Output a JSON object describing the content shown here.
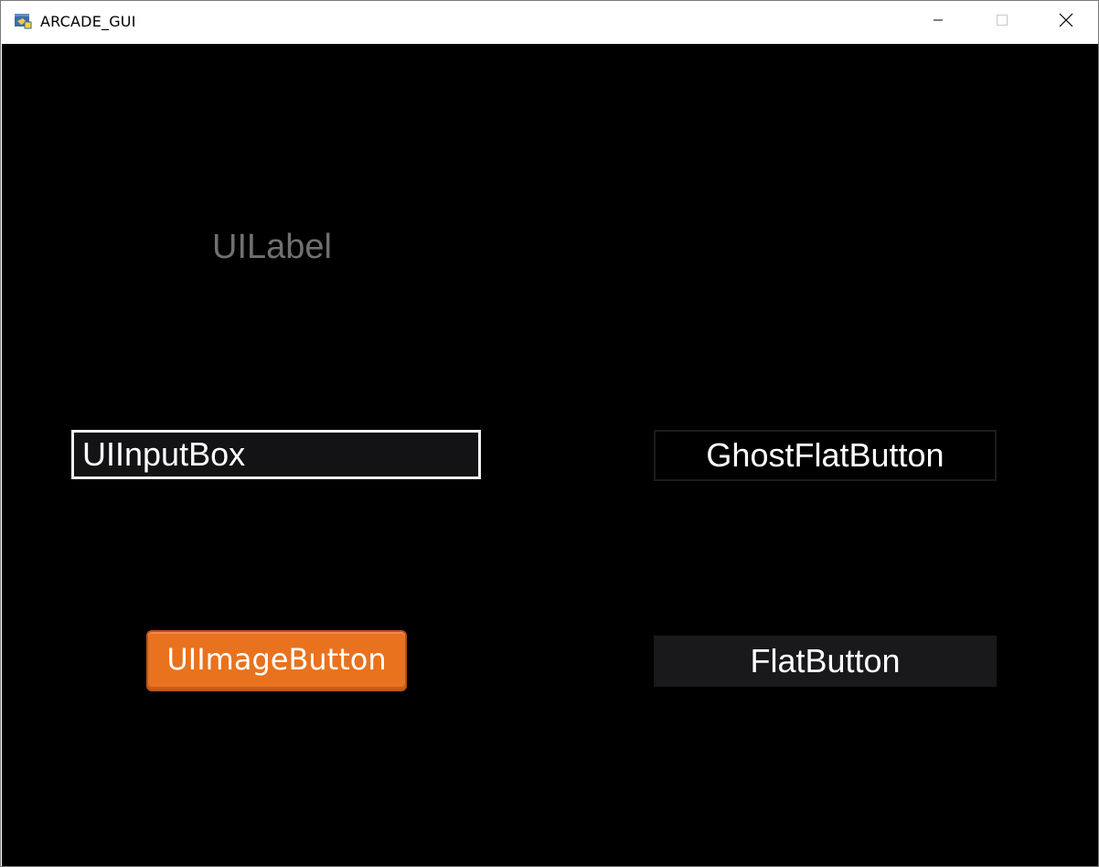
{
  "window": {
    "title": "ARCADE_GUI",
    "icon": "python-app-icon",
    "controls": {
      "minimize_icon": "minimize-icon",
      "maximize_icon": "maximize-icon",
      "close_icon": "close-icon"
    }
  },
  "canvas": {
    "background": "#000000",
    "label": {
      "text": "UILabel",
      "color": "#707070"
    },
    "input_box": {
      "value": "UIInputBox",
      "border_color": "#f2f2f2"
    },
    "ghost_flat_button": {
      "label": "GhostFlatButton"
    },
    "image_button": {
      "label": "UIImageButton",
      "color": "#e8721e"
    },
    "flat_button": {
      "label": "FlatButton",
      "color": "#19181b"
    }
  }
}
